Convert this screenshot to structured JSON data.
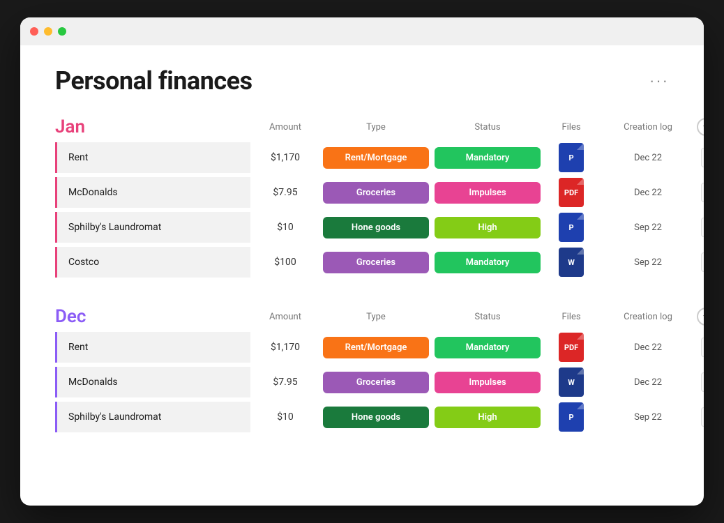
{
  "window": {
    "title": "Personal finances"
  },
  "page": {
    "title": "Personal finances",
    "more_label": "···"
  },
  "sections": [
    {
      "id": "jan",
      "month": "Jan",
      "color_class": "jan-color",
      "section_class": "",
      "columns": {
        "amount": "Amount",
        "type": "Type",
        "status": "Status",
        "files": "Files",
        "creation_log": "Creation log"
      },
      "rows": [
        {
          "name": "Rent",
          "amount": "$1,170",
          "type": "Rent/Mortgage",
          "type_class": "badge-orange",
          "status": "Mandatory",
          "status_class": "badge-green",
          "file_icon": "P",
          "file_icon_class": "file-icon-blue",
          "creation_log": "Dec 22"
        },
        {
          "name": "McDonalds",
          "amount": "$7.95",
          "type": "Groceries",
          "type_class": "badge-purple",
          "status": "Impulses",
          "status_class": "badge-pink",
          "file_icon": "PDF",
          "file_icon_class": "file-icon-red",
          "creation_log": "Dec 22"
        },
        {
          "name": "Sphilby's Laundromat",
          "amount": "$10",
          "type": "Hone goods",
          "type_class": "badge-dark-green",
          "status": "High",
          "status_class": "badge-lime",
          "file_icon": "P",
          "file_icon_class": "file-icon-blue",
          "creation_log": "Sep 22"
        },
        {
          "name": "Costco",
          "amount": "$100",
          "type": "Groceries",
          "type_class": "badge-purple",
          "status": "Mandatory",
          "status_class": "badge-green",
          "file_icon": "W",
          "file_icon_class": "file-icon-dark-blue",
          "creation_log": "Sep 22"
        }
      ]
    },
    {
      "id": "dec",
      "month": "Dec",
      "color_class": "dec-color",
      "section_class": "dec-section",
      "columns": {
        "amount": "Amount",
        "type": "Type",
        "status": "Status",
        "files": "Files",
        "creation_log": "Creation log"
      },
      "rows": [
        {
          "name": "Rent",
          "amount": "$1,170",
          "type": "Rent/Mortgage",
          "type_class": "badge-orange",
          "status": "Mandatory",
          "status_class": "badge-green",
          "file_icon": "PDF",
          "file_icon_class": "file-icon-red",
          "creation_log": "Dec 22"
        },
        {
          "name": "McDonalds",
          "amount": "$7.95",
          "type": "Groceries",
          "type_class": "badge-purple",
          "status": "Impulses",
          "status_class": "badge-pink",
          "file_icon": "W",
          "file_icon_class": "file-icon-dark-blue",
          "creation_log": "Dec 22"
        },
        {
          "name": "Sphilby's Laundromat",
          "amount": "$10",
          "type": "Hone goods",
          "type_class": "badge-dark-green",
          "status": "High",
          "status_class": "badge-lime",
          "file_icon": "P",
          "file_icon_class": "file-icon-blue",
          "creation_log": "Sep 22"
        }
      ]
    }
  ]
}
